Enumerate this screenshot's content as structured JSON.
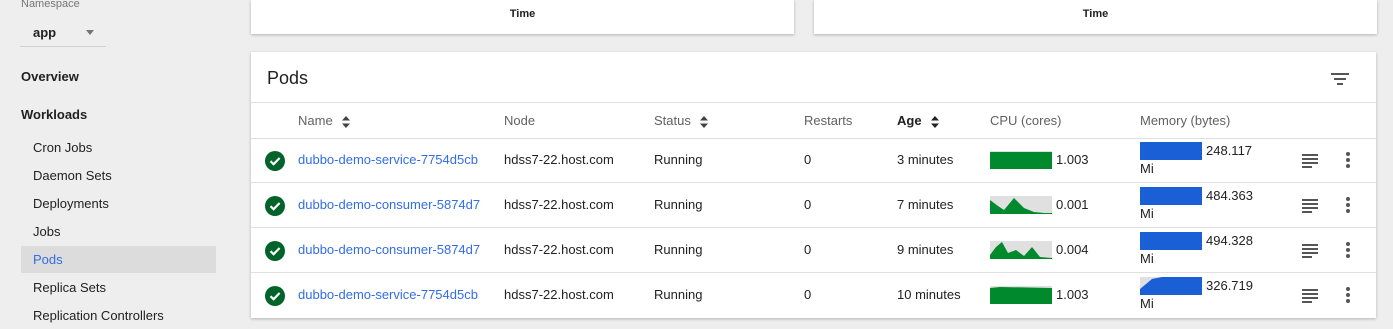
{
  "sidebar": {
    "namespace_label": "Namespace",
    "namespace_value": "app",
    "overview": "Overview",
    "workloads": "Workloads",
    "items": [
      {
        "label": "Cron Jobs"
      },
      {
        "label": "Daemon Sets"
      },
      {
        "label": "Deployments"
      },
      {
        "label": "Jobs"
      },
      {
        "label": "Pods",
        "active": true
      },
      {
        "label": "Replica Sets"
      },
      {
        "label": "Replication Controllers"
      }
    ]
  },
  "charts_top": {
    "left_xlabel": "Time",
    "right_xlabel": "Time"
  },
  "pods": {
    "title": "Pods",
    "columns": {
      "name": "Name",
      "node": "Node",
      "status": "Status",
      "restarts": "Restarts",
      "age": "Age",
      "cpu": "CPU (cores)",
      "memory": "Memory (bytes)"
    },
    "rows": [
      {
        "name": "dubbo-demo-service-7754d5cb",
        "node": "hdss7-22.host.com",
        "status": "Running",
        "restarts": "0",
        "age": "3 minutes",
        "cpu": "1.003",
        "memory": "248.117",
        "memory_unit": "Mi"
      },
      {
        "name": "dubbo-demo-consumer-5874d7",
        "node": "hdss7-22.host.com",
        "status": "Running",
        "restarts": "0",
        "age": "7 minutes",
        "cpu": "0.001",
        "memory": "484.363",
        "memory_unit": "Mi"
      },
      {
        "name": "dubbo-demo-consumer-5874d7",
        "node": "hdss7-22.host.com",
        "status": "Running",
        "restarts": "0",
        "age": "9 minutes",
        "cpu": "0.004",
        "memory": "494.328",
        "memory_unit": "Mi"
      },
      {
        "name": "dubbo-demo-service-7754d5cb",
        "node": "hdss7-22.host.com",
        "status": "Running",
        "restarts": "0",
        "age": "10 minutes",
        "cpu": "1.003",
        "memory": "326.719",
        "memory_unit": "Mi"
      }
    ]
  },
  "colors": {
    "accent": "#326de6",
    "status_ok": "#00642a",
    "cpu_spark": "#00892d",
    "memory_spark": "#1a5fd6"
  },
  "icons": {
    "status": "check-circle-icon",
    "logs": "logs-icon",
    "menu": "more-vert-icon",
    "filter": "filter-icon",
    "sort": "sort-icon"
  }
}
